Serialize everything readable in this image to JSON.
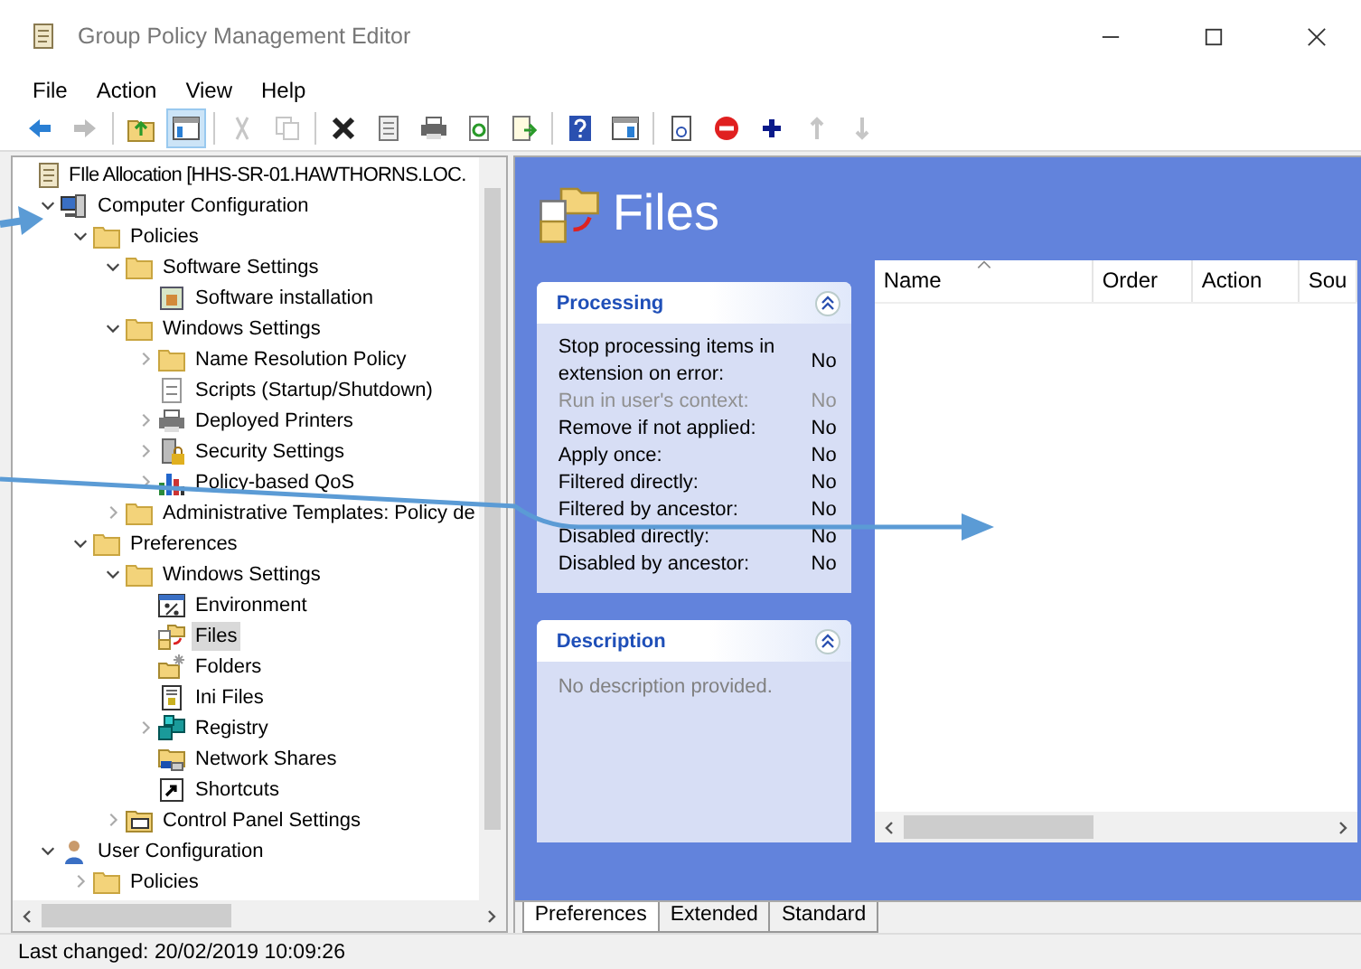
{
  "window": {
    "title": "Group Policy Management Editor"
  },
  "menu": [
    "File",
    "Action",
    "View",
    "Help"
  ],
  "toolbar": [
    {
      "kind": "back",
      "disabled": false,
      "pressed": false
    },
    {
      "kind": "forward",
      "disabled": true,
      "pressed": false
    },
    {
      "kind": "sep"
    },
    {
      "kind": "up",
      "disabled": false,
      "pressed": false
    },
    {
      "kind": "tree",
      "disabled": false,
      "pressed": true
    },
    {
      "kind": "sep"
    },
    {
      "kind": "cut",
      "disabled": true,
      "pressed": false
    },
    {
      "kind": "copy",
      "disabled": true,
      "pressed": false
    },
    {
      "kind": "sep"
    },
    {
      "kind": "delete",
      "disabled": false,
      "pressed": false
    },
    {
      "kind": "properties",
      "disabled": false,
      "pressed": false
    },
    {
      "kind": "print",
      "disabled": false,
      "pressed": false
    },
    {
      "kind": "refresh",
      "disabled": false,
      "pressed": false
    },
    {
      "kind": "export",
      "disabled": false,
      "pressed": false
    },
    {
      "kind": "sep"
    },
    {
      "kind": "help",
      "disabled": false,
      "pressed": false
    },
    {
      "kind": "pane",
      "disabled": false,
      "pressed": false
    },
    {
      "kind": "sep"
    },
    {
      "kind": "doc",
      "disabled": false,
      "pressed": false
    },
    {
      "kind": "stop",
      "disabled": false,
      "pressed": false
    },
    {
      "kind": "plus",
      "disabled": false,
      "pressed": false
    },
    {
      "kind": "moveup",
      "disabled": true,
      "pressed": false
    },
    {
      "kind": "movedown",
      "disabled": true,
      "pressed": false
    }
  ],
  "tree": {
    "label": "FIle Allocation [HHS-SR-01.HAWTHORNS.LOC.",
    "kind": "gpo",
    "children": [
      {
        "label": "Computer Configuration",
        "kind": "computer",
        "expanded": true,
        "selected": false,
        "children": [
          {
            "label": "Policies",
            "kind": "folder",
            "expanded": true,
            "selected": false,
            "children": [
              {
                "label": "Software Settings",
                "kind": "folder",
                "expanded": true,
                "selected": false,
                "children": [
                  {
                    "label": "Software installation",
                    "kind": "app",
                    "selected": false
                  }
                ]
              },
              {
                "label": "Windows Settings",
                "kind": "folder",
                "expanded": true,
                "selected": false,
                "children": [
                  {
                    "label": "Name Resolution Policy",
                    "kind": "folder",
                    "expanded": false,
                    "selected": false
                  },
                  {
                    "label": "Scripts (Startup/Shutdown)",
                    "kind": "script",
                    "selected": false
                  },
                  {
                    "label": "Deployed Printers",
                    "kind": "printer",
                    "expanded": false,
                    "selected": false
                  },
                  {
                    "label": "Security Settings",
                    "kind": "security",
                    "expanded": false,
                    "selected": false
                  },
                  {
                    "label": "Policy-based QoS",
                    "kind": "chart",
                    "expanded": false,
                    "selected": false
                  }
                ]
              },
              {
                "label": "Administrative Templates: Policy de",
                "kind": "folder",
                "expanded": false,
                "selected": false
              }
            ]
          },
          {
            "label": "Preferences",
            "kind": "folder",
            "expanded": true,
            "selected": false,
            "children": [
              {
                "label": "Windows Settings",
                "kind": "folder",
                "expanded": true,
                "selected": false,
                "children": [
                  {
                    "label": "Environment",
                    "kind": "env",
                    "selected": false
                  },
                  {
                    "label": "Files",
                    "kind": "files",
                    "selected": true
                  },
                  {
                    "label": "Folders",
                    "kind": "newfolder",
                    "selected": false
                  },
                  {
                    "label": "Ini Files",
                    "kind": "ini",
                    "selected": false
                  },
                  {
                    "label": "Registry",
                    "kind": "registry",
                    "expanded": false,
                    "selected": false
                  },
                  {
                    "label": "Network Shares",
                    "kind": "share",
                    "selected": false
                  },
                  {
                    "label": "Shortcuts",
                    "kind": "shortcut",
                    "selected": false
                  }
                ]
              },
              {
                "label": "Control Panel Settings",
                "kind": "control",
                "expanded": false,
                "selected": false
              }
            ]
          }
        ]
      },
      {
        "label": "User Configuration",
        "kind": "user",
        "expanded": true,
        "selected": false,
        "children": [
          {
            "label": "Policies",
            "kind": "folder",
            "expanded": false,
            "selected": false
          }
        ]
      }
    ]
  },
  "details": {
    "title": "Files",
    "processing": {
      "title": "Processing",
      "rows": [
        {
          "label": "Stop processing items in extension on error:",
          "value": "No",
          "disabled": false
        },
        {
          "label": "Run in user's context:",
          "value": "No",
          "disabled": true
        },
        {
          "label": "Remove if not applied:",
          "value": "No",
          "disabled": false
        },
        {
          "label": "Apply once:",
          "value": "No",
          "disabled": false
        },
        {
          "label": "Filtered directly:",
          "value": "No",
          "disabled": false
        },
        {
          "label": "Filtered by ancestor:",
          "value": "No",
          "disabled": false
        },
        {
          "label": "Disabled directly:",
          "value": "No",
          "disabled": false
        },
        {
          "label": "Disabled by ancestor:",
          "value": "No",
          "disabled": false
        }
      ]
    },
    "description": {
      "title": "Description",
      "text": "No description provided."
    },
    "table": {
      "columns": [
        "Name",
        "Order",
        "Action",
        "Sou"
      ]
    }
  },
  "tabs": [
    {
      "label": "Preferences",
      "selected": true
    },
    {
      "label": "Extended",
      "selected": false
    },
    {
      "label": "Standard",
      "selected": false
    }
  ],
  "status_bar": "Last changed: 20/02/2019 10:09:26"
}
